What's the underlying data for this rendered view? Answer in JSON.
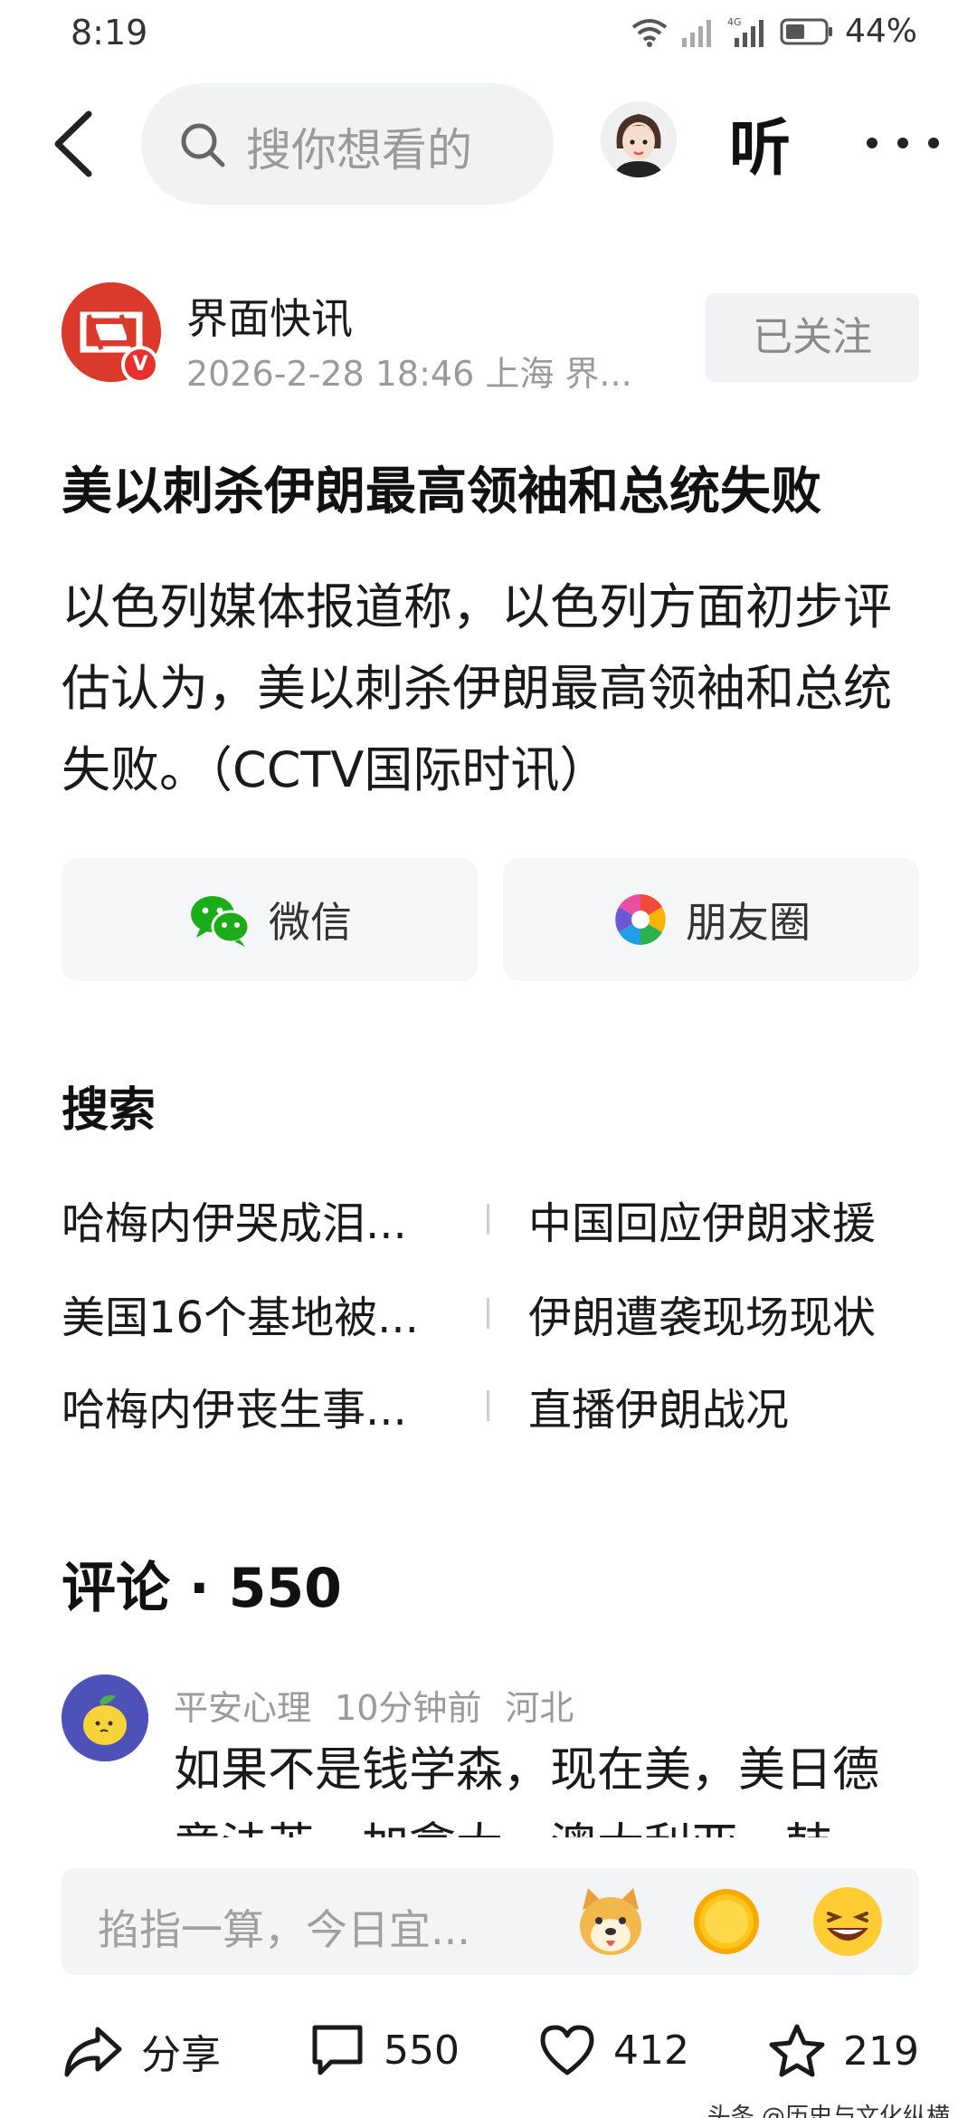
{
  "status_bar": {
    "time": "8:19",
    "battery": "44%"
  },
  "topnav": {
    "search_placeholder": "搜你想看的",
    "listen_label": "听"
  },
  "author": {
    "name": "界面快讯",
    "meta": "2026-2-28  18:46  上海  界...",
    "follow_label": "已关注",
    "verified_mark": "V"
  },
  "article": {
    "title": "美以刺杀伊朗最高领袖和总统失败",
    "body": "以色列媒体报道称，以色列方面初步评估认为，美以刺杀伊朗最高领袖和总统失败。（CCTV国际时讯）"
  },
  "share": {
    "wechat_label": "微信",
    "moments_label": "朋友圈"
  },
  "search_section": {
    "title": "搜索",
    "suggestions": [
      {
        "left": "哈梅内伊哭成泪...",
        "right": "中国回应伊朗求援"
      },
      {
        "left": "美国16个基地被...",
        "right": "伊朗遭袭现场现状"
      },
      {
        "left": "哈梅内伊丧生事...",
        "right": "直播伊朗战况"
      }
    ]
  },
  "comments": {
    "title": "评论 · 550",
    "items": [
      {
        "user": "平安心理",
        "time": "10分钟前",
        "location": "河北",
        "text": "如果不是钱学森，现在美，美日德意法英，加拿大，澳大利亚，韩"
      }
    ]
  },
  "input_bar": {
    "placeholder": "掐指一算，今日宜..."
  },
  "bottom_bar": {
    "share_label": "分享",
    "comment_count": "550",
    "like_count": "412",
    "fav_count": "219"
  },
  "watermark": "头条 @历史与文化纵横",
  "colors": {
    "brand_red": "#d93a2b",
    "wechat_green": "#1aad19",
    "comment_avatar_bg": "#4e52b8"
  }
}
